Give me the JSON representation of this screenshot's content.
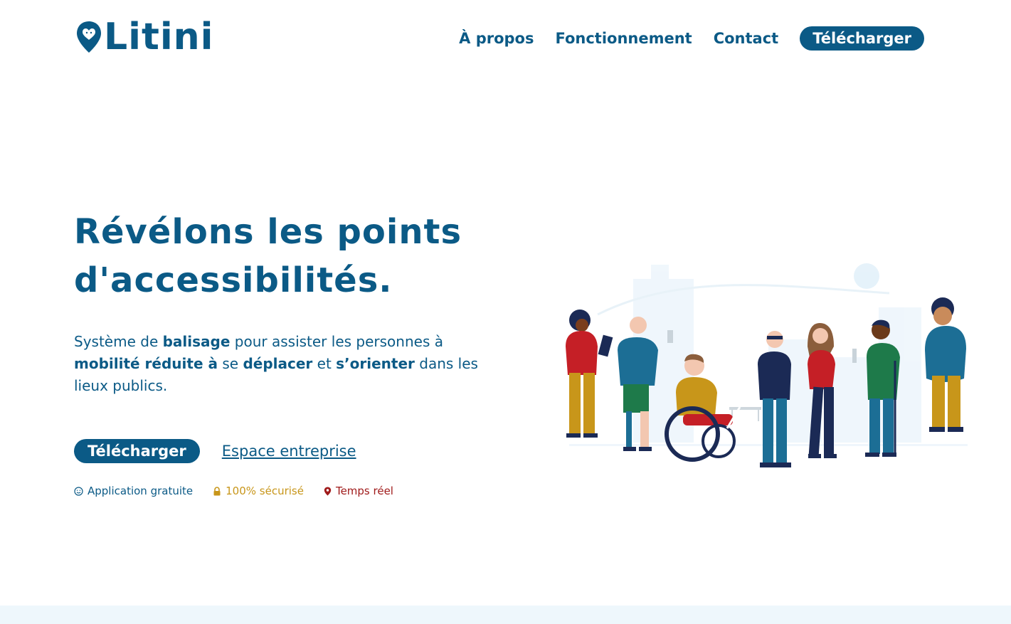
{
  "header": {
    "logo_text": "Litini",
    "nav": {
      "about": "À propos",
      "how_it_works": "Fonctionnement",
      "contact": "Contact",
      "download": "Télécharger"
    }
  },
  "hero": {
    "title_line1": "Révélons les points",
    "title_line2": "d'accessibilités.",
    "desc": {
      "p1": "Système de ",
      "b1": "balisage",
      "p2": " pour assister les personnes à ",
      "b2": "mobilité réduite à",
      "p3": " se ",
      "b3": "déplacer",
      "p4": " et ",
      "b4": "s’orienter",
      "p5": " dans les lieux publics."
    },
    "cta_primary": "Télécharger",
    "cta_secondary": "Espace entreprise",
    "features": {
      "free": "Application gratuite",
      "secure": "100% sécurisé",
      "realtime": "Temps réel"
    }
  },
  "colors": {
    "primary": "#0b5a86",
    "gold": "#c8961a",
    "red": "#a01b1b",
    "light_bg": "#eef7fc"
  },
  "icons": {
    "logo": "map-pin-heart-icon",
    "free": "smile-icon",
    "secure": "lock-icon",
    "realtime": "location-pin-icon"
  }
}
